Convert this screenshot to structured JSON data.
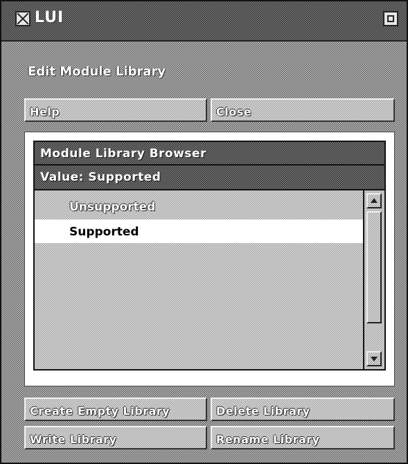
{
  "window": {
    "title": "LUI",
    "close_icon": "close-box-icon",
    "maximize_icon": "maximize-icon"
  },
  "panel": {
    "title": "Edit Module Library"
  },
  "top_buttons": {
    "help": "Help",
    "close": "Close"
  },
  "browser": {
    "title": "Module Library Browser",
    "value_label": "Value: Supported",
    "items": [
      {
        "label": "Unsupported",
        "selected": false
      },
      {
        "label": "Supported",
        "selected": true
      }
    ]
  },
  "bottom_buttons": {
    "create": "Create Empty Library",
    "delete": "Delete Library",
    "write": "Write Library",
    "rename": "Rename Library"
  }
}
